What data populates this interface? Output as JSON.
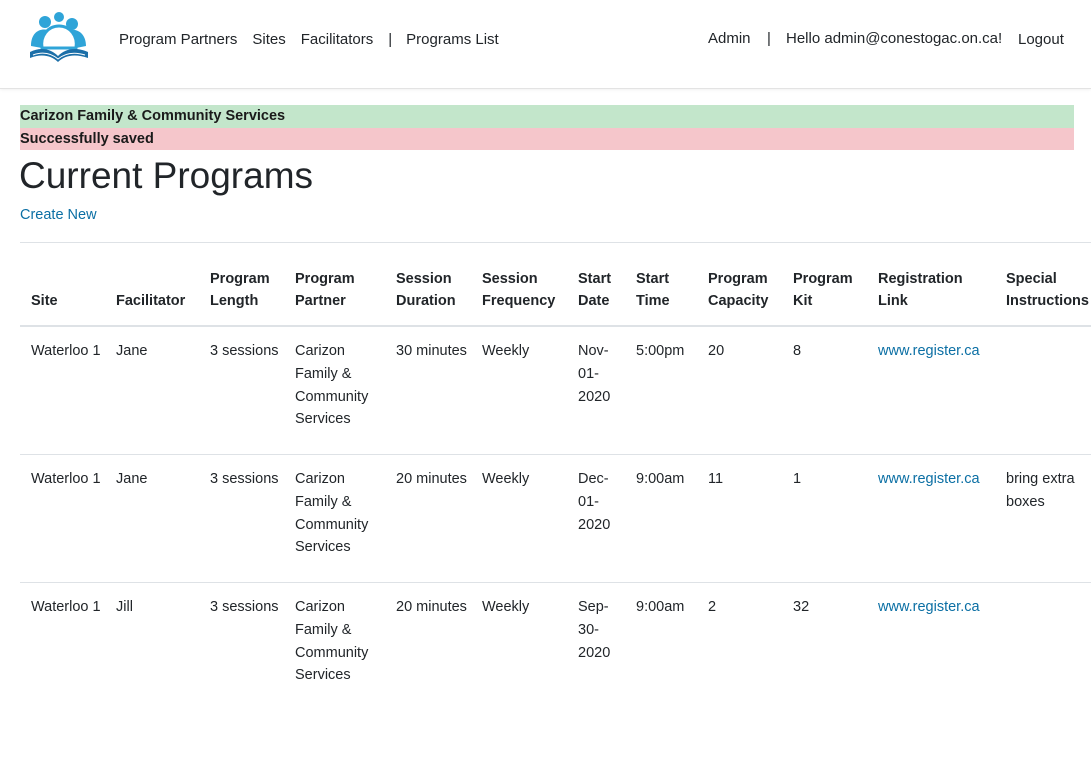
{
  "nav": {
    "links": [
      "Program Partners",
      "Sites",
      "Facilitators"
    ],
    "separator": "|",
    "programs_list": "Programs List",
    "admin": "Admin",
    "right_separator": "|",
    "greeting": "Hello admin@conestogac.on.ca!",
    "logout": "Logout"
  },
  "alerts": {
    "partner": "Carizon Family & Community Services",
    "saved": "Successfully saved"
  },
  "page": {
    "title": "Current Programs",
    "create_new": "Create New"
  },
  "table": {
    "headers": [
      "Site",
      "Facilitator",
      "Program Length",
      "Program Partner",
      "Session Duration",
      "Session Frequency",
      "Start Date",
      "Start Time",
      "Program Capacity",
      "Program Kit",
      "Registration Link",
      "Special Instructions"
    ],
    "rows": [
      [
        "Waterloo 1",
        "Jane",
        "3 sessions",
        "Carizon Family & Community Services",
        "30 minutes",
        "Weekly",
        "Nov-01-2020",
        "5:00pm",
        "20",
        "8",
        "www.register.ca",
        ""
      ],
      [
        "Waterloo 1",
        "Jane",
        "3 sessions",
        "Carizon Family & Community Services",
        "20 minutes",
        "Weekly",
        "Dec-01-2020",
        "9:00am",
        "11",
        "1",
        "www.register.ca",
        "bring extra boxes"
      ],
      [
        "Waterloo 1",
        "Jill",
        "3 sessions",
        "Carizon Family & Community Services",
        "20 minutes",
        "Weekly",
        "Sep-30-2020",
        "9:00am",
        "2",
        "32",
        "www.register.ca",
        ""
      ]
    ]
  },
  "colors": {
    "link": "#0b6fa4",
    "success_bg": "#c3e6cb",
    "danger_bg": "#f5c6cb",
    "logo_blue": "#2fa4d8"
  }
}
